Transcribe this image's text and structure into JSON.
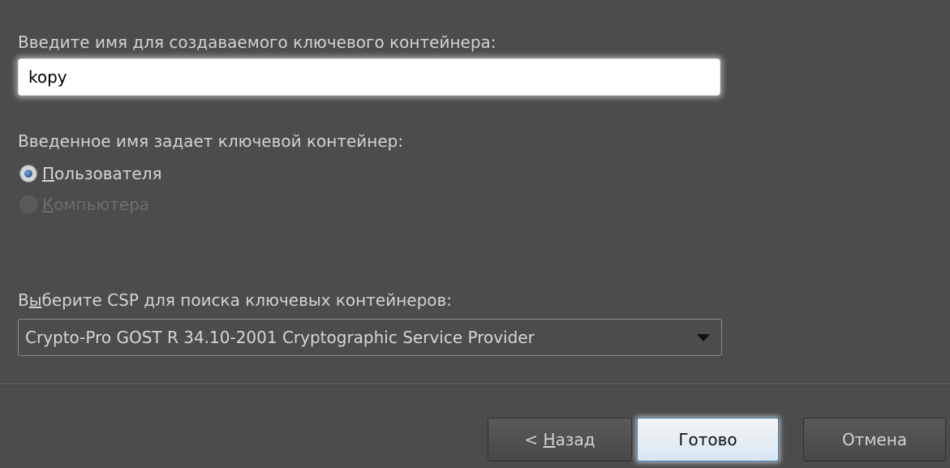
{
  "form": {
    "name_label": "Введите имя для создаваемого ключевого контейнера:",
    "name_value": "kopy",
    "scope_label": "Введенное имя задает ключевой контейнер:",
    "scope_options": [
      {
        "mnemonic": "П",
        "rest": "ользователя",
        "checked": true,
        "enabled": true
      },
      {
        "mnemonic": "К",
        "rest": "омпьютера",
        "checked": false,
        "enabled": false
      }
    ],
    "csp_label_pre": "В",
    "csp_label_mnemonic": "ы",
    "csp_label_post": "берите CSP для поиска ключевых контейнеров:",
    "csp_selected": "Crypto-Pro GOST R 34.10-2001 Cryptographic Service Provider"
  },
  "buttons": {
    "back_prefix": "< ",
    "back_mnemonic": "Н",
    "back_rest": "азад",
    "finish_label": "Готово",
    "cancel_label": "Отмена"
  },
  "colors": {
    "background": "#4c4c4c",
    "text": "#d2d2d2",
    "primary_border": "#3c7fb1"
  },
  "icons": {
    "dropdown": "chevron-down-icon"
  }
}
